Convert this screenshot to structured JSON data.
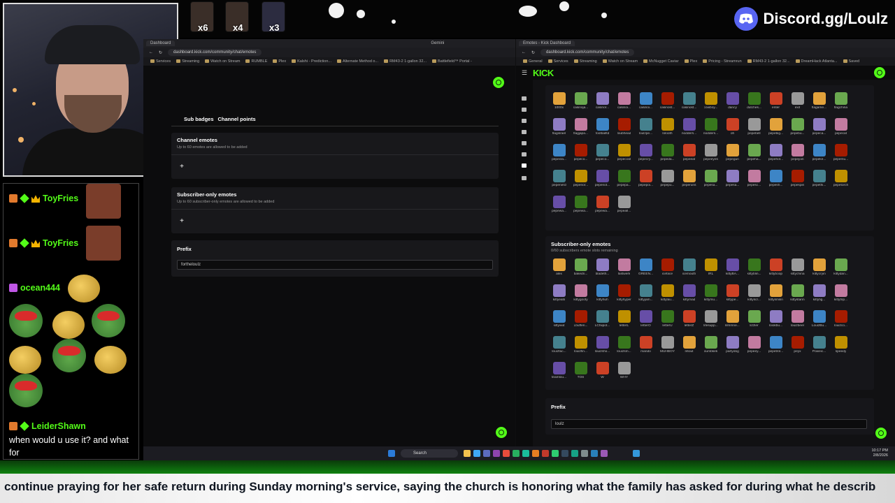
{
  "overlay": {
    "discord_text": "Discord.gg/Loulz",
    "emote_counts": [
      "x6",
      "x4",
      "x3"
    ]
  },
  "chat": {
    "messages": [
      {
        "user": "ToyFries"
      },
      {
        "user": "ToyFries"
      },
      {
        "user": "ocean444"
      },
      {
        "user": "LeiderShawn",
        "text": "when would u use it? and what for"
      }
    ]
  },
  "left_browser": {
    "tabs": [
      "Dashboard",
      "Gemini"
    ],
    "url": "dashboard.kick.com/community/chat/emotes",
    "bookmarks": [
      "Services",
      "Streaming",
      "Watch on Stream",
      "RUMBLE",
      "Plex",
      "Kalshi - Prediction...",
      "Alternate Method o...",
      "RM43-2 1-gallon 32...",
      "Battlefield™ Portal -"
    ],
    "subtabs": [
      "Sub badges",
      "Channel points"
    ],
    "channel_emotes": {
      "title": "Channel emotes",
      "sub": "Up to 60 emotes are allowed to be added"
    },
    "subscriber_emotes": {
      "title": "Subscriber-only emotes",
      "sub": "Up to 60 subscriber-only emotes are allowed to be added"
    },
    "prefix": {
      "title": "Prefix",
      "value": "forthelouIz"
    },
    "add_label": "+"
  },
  "right_browser": {
    "tab": "Emotes - Kick Dashboard",
    "url": "dashboard.kick.com/community/chat/emotes",
    "bookmarks": [
      "General",
      "Services",
      "Streaming",
      "Watch on Stream",
      "McNugget Caviar",
      "Plex",
      "Pricing - Streamrun",
      "RM43-2 1-gallon 32...",
      "DreamHack Atlanta...",
      "Saved"
    ],
    "logo": "KICK",
    "channel_emotes": [
      "1000x",
      "casinoja...",
      "casinor...",
      "casinoi...",
      "casinoi...",
      "casinost...",
      "casinost...",
      "cowboy...",
      "dancy",
      "dutches...",
      "enter",
      "exit",
      "flagame...",
      "flagchina",
      "flagisrael",
      "flagjapa...",
      "footballtd",
      "loubhead",
      "loulzpe...",
      "lolooth",
      "nodders...",
      "nodders...",
      "oh",
      "pepebell",
      "pepebig...",
      "pepebu...",
      "pepeca...",
      "pepecat",
      "pepecla...",
      "pepeco...",
      "pepeco...",
      "pepecool",
      "pepecry...",
      "pepeda...",
      "pepeeat",
      "pepeeyes",
      "pepegun",
      "pepeha...",
      "pepehot...",
      "pepejoin",
      "pepeke...",
      "pepemu...",
      "pepenerd",
      "pepenor...",
      "pepenot...",
      "pepepa...",
      "pepepoi...",
      "pepepu...",
      "peperuns",
      "pepesa...",
      "pepesa...",
      "pepesc...",
      "pepesh...",
      "pepespin",
      "pepethi...",
      "pepetorch",
      "pepewa...",
      "pepewa...",
      "pepewa...",
      "pepeall..."
    ],
    "subscriber_section": {
      "title": "Subscriber-only emotes",
      "sub": "0/60 subscribers emote slots remaining"
    },
    "subscriber_emotes": [
      "alex",
      "bakedn...",
      "bladeth...",
      "fastwerk",
      "GREEN...",
      "iceface",
      "icemouth",
      "IRL",
      "kittyBA...",
      "kittyblin...",
      "kittyboop",
      "kittychina",
      "kittycryin",
      "kittydan...",
      "kittyeats",
      "kittygoofy",
      "kittyhuh",
      "kittyhyper",
      "kittyjam...",
      "kittylau...",
      "kittymad",
      "kittymu...",
      "kittype...",
      "kittyscr...",
      "kittysmilin",
      "kittystarin",
      "kittyfig...",
      "kittytrip...",
      "kittywut",
      "Lbufferi...",
      "LChiipot...",
      "letterL",
      "letterO",
      "letterU",
      "letterZ",
      "lifesupp...",
      "lilmmne...",
      "lizzler",
      "loiokbu...",
      "louizbeer",
      "LouizBu...",
      "louizco...",
      "louizfac...",
      "louizfin...",
      "louizsho...",
      "louizsm...",
      "mando",
      "MUHBOY",
      "n6out",
      "oumbkek",
      "partydog",
      "pepeey...",
      "pepetrol...",
      "peyx",
      "Poweic...",
      "speedy",
      "teamlou...",
      "TOS",
      "W",
      "WHY"
    ],
    "prefix": {
      "title": "Prefix",
      "value": "louIz"
    }
  },
  "taskbar": {
    "search_label": "Search",
    "clock_time": "10:17 PM",
    "clock_date": "2/8/2026"
  },
  "ticker": {
    "text": "continue praying for her safe return during Sunday morning's service, saying the church is honoring what the family has asked for during what he describ"
  },
  "colors": {
    "kick_green": "#53fc18",
    "discord_blurple": "#5865f2",
    "page_bg": "#0c0c0d",
    "card_bg": "#18181b"
  }
}
